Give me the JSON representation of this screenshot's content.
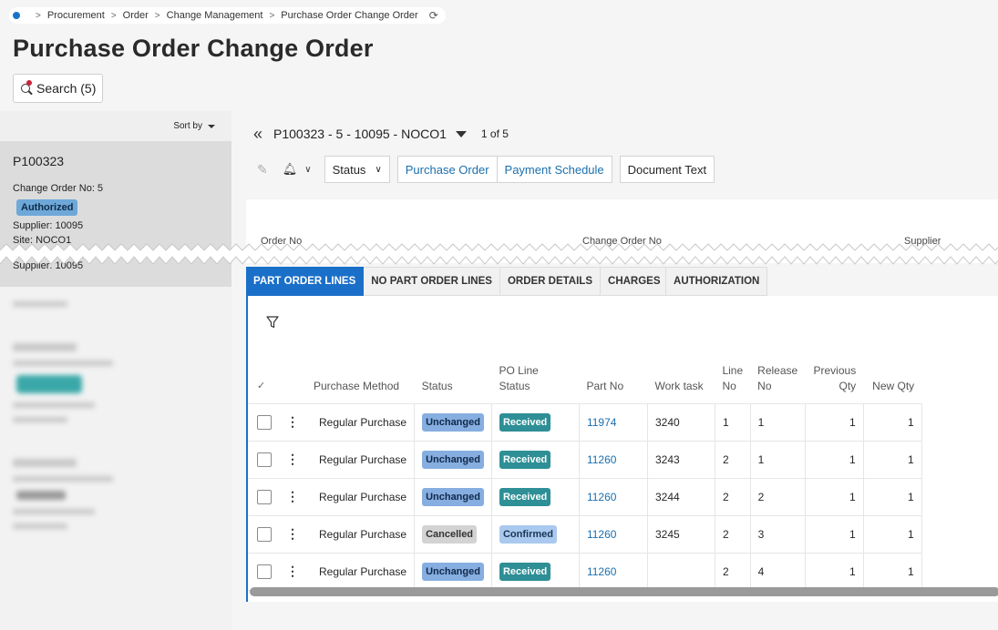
{
  "breadcrumb": {
    "items": [
      "Procurement",
      "Order",
      "Change Management",
      "Purchase Order Change Order"
    ]
  },
  "page": {
    "title": "Purchase Order Change Order"
  },
  "search": {
    "label": "Search (5)"
  },
  "list": {
    "sort_label": "Sort by",
    "selected": {
      "po": "P100323",
      "change_order_line": "Change Order No:  5",
      "status_badge": "Authorized",
      "supplier_line": "Supplier:  10095",
      "site_line": "Site:  NOCO1",
      "supplier_line_repeat": "Supplier:  10095"
    }
  },
  "record": {
    "title": "P100323 - 5 - 10095 - NOCO1",
    "counter": "1 of 5"
  },
  "toolbar": {
    "status_label": "Status",
    "purchase_order_label": "Purchase Order",
    "payment_schedule_label": "Payment Schedule",
    "document_text_label": "Document Text"
  },
  "detail": {
    "order_no_label": "Order No",
    "change_order_no_label": "Change Order No",
    "supplier_label": "Supplier"
  },
  "tabs": [
    "PART ORDER LINES",
    "NO PART ORDER LINES",
    "ORDER DETAILS",
    "CHARGES",
    "AUTHORIZATION"
  ],
  "grid": {
    "columns": {
      "purchase_method": "Purchase Method",
      "status": "Status",
      "po_line_status": "PO Line Status",
      "part_no": "Part No",
      "work_task": "Work task",
      "line_no_1": "Line",
      "line_no_2": "No",
      "release_no_1": "Release",
      "release_no_2": "No",
      "previous_qty_1": "Previous",
      "previous_qty_2": "Qty",
      "new_qty": "New Qty"
    },
    "rows": [
      {
        "purchase_method": "Regular Purchase",
        "status": "Unchanged",
        "po_line_status": "Received",
        "part_no": "11974",
        "work_task": "3240",
        "line_no": "1",
        "release_no": "1",
        "previous_qty": "1",
        "new_qty": "1"
      },
      {
        "purchase_method": "Regular Purchase",
        "status": "Unchanged",
        "po_line_status": "Received",
        "part_no": "11260",
        "work_task": "3243",
        "line_no": "2",
        "release_no": "1",
        "previous_qty": "1",
        "new_qty": "1"
      },
      {
        "purchase_method": "Regular Purchase",
        "status": "Unchanged",
        "po_line_status": "Received",
        "part_no": "11260",
        "work_task": "3244",
        "line_no": "2",
        "release_no": "2",
        "previous_qty": "1",
        "new_qty": "1"
      },
      {
        "purchase_method": "Regular Purchase",
        "status": "Cancelled",
        "po_line_status": "Confirmed",
        "part_no": "11260",
        "work_task": "3245",
        "line_no": "2",
        "release_no": "3",
        "previous_qty": "1",
        "new_qty": "1"
      },
      {
        "purchase_method": "Regular Purchase",
        "status": "Unchanged",
        "po_line_status": "Received",
        "part_no": "11260",
        "work_task": "",
        "line_no": "2",
        "release_no": "4",
        "previous_qty": "1",
        "new_qty": "1"
      }
    ]
  },
  "colors": {
    "accent": "#1a6fc8",
    "link": "#1a6fad",
    "received": "#2e8f96",
    "unchanged": "#86aee0",
    "authorized": "#6ea8d8"
  }
}
